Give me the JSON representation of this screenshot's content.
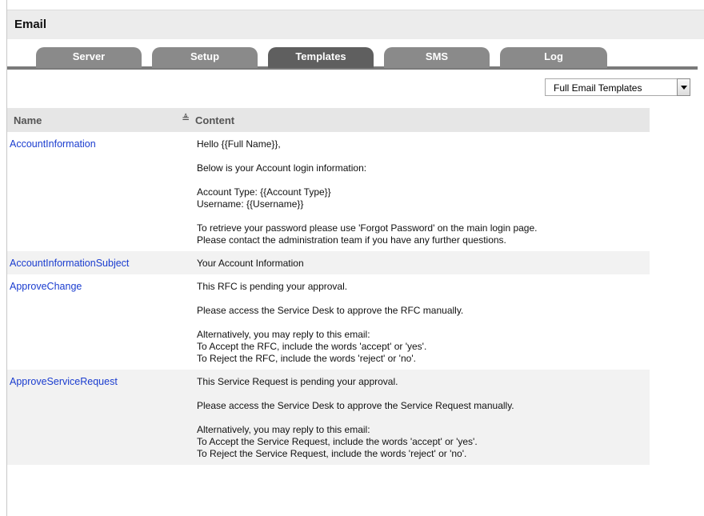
{
  "page": {
    "title": "Email"
  },
  "tabs": [
    {
      "label": "Server",
      "active": false
    },
    {
      "label": "Setup",
      "active": false
    },
    {
      "label": "Templates",
      "active": true
    },
    {
      "label": "SMS",
      "active": false
    },
    {
      "label": "Log",
      "active": false
    }
  ],
  "filter": {
    "selected": "Full Email Templates"
  },
  "table": {
    "columns": {
      "name": "Name",
      "content": "Content"
    },
    "rows": [
      {
        "name": "AccountInformation",
        "paragraphs": [
          [
            "Hello {{Full Name}},"
          ],
          [
            "Below is your Account login information:"
          ],
          [
            "Account Type: {{Account Type}}",
            "Username: {{Username}}"
          ],
          [
            "To retrieve your password please use 'Forgot Password' on the main login page.",
            "Please contact the administration team if you have any further questions."
          ]
        ]
      },
      {
        "name": "AccountInformationSubject",
        "paragraphs": [
          [
            "Your Account Information"
          ]
        ]
      },
      {
        "name": "ApproveChange",
        "paragraphs": [
          [
            "This RFC is pending your approval."
          ],
          [
            "Please access the Service Desk to approve the RFC manually."
          ],
          [
            "Alternatively, you may reply to this email:",
            "To Accept the RFC, include the words 'accept' or 'yes'.",
            "To Reject the RFC, include the words 'reject' or 'no'."
          ]
        ]
      },
      {
        "name": "ApproveServiceRequest",
        "paragraphs": [
          [
            "This Service Request is pending your approval."
          ],
          [
            "Please access the Service Desk to approve the Service Request manually."
          ],
          [
            "Alternatively, you may reply to this email:",
            "To Accept the Service Request, include the words 'accept' or 'yes'.",
            "To Reject the Service Request, include the words 'reject' or 'no'."
          ]
        ]
      }
    ]
  }
}
